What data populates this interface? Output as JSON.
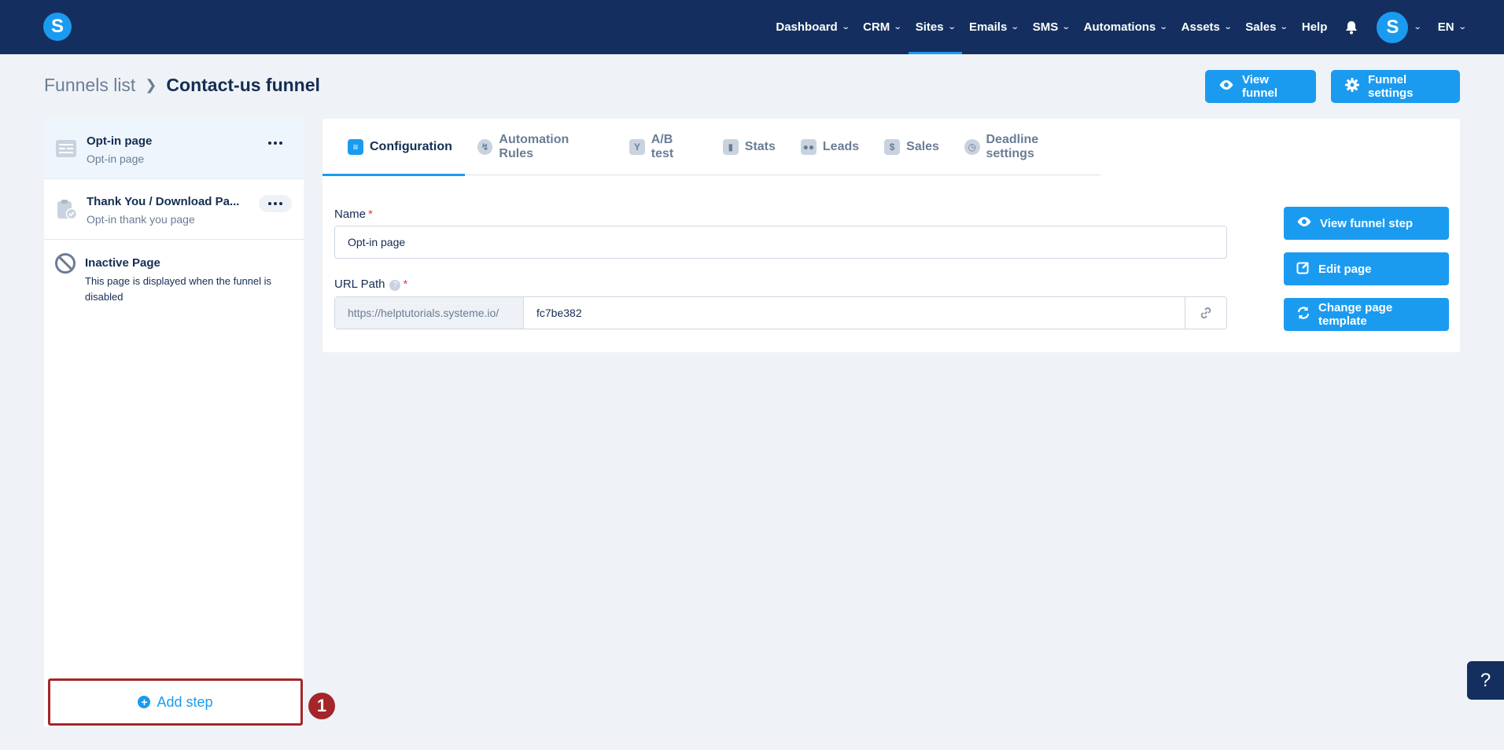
{
  "nav": {
    "logo": "S",
    "items": [
      {
        "label": "Dashboard",
        "has_dropdown": true
      },
      {
        "label": "CRM",
        "has_dropdown": true
      },
      {
        "label": "Sites",
        "has_dropdown": true,
        "active": true
      },
      {
        "label": "Emails",
        "has_dropdown": true
      },
      {
        "label": "SMS",
        "has_dropdown": true
      },
      {
        "label": "Automations",
        "has_dropdown": true
      },
      {
        "label": "Assets",
        "has_dropdown": true
      },
      {
        "label": "Sales",
        "has_dropdown": true
      },
      {
        "label": "Help",
        "has_dropdown": false
      }
    ],
    "avatar": "S",
    "language": "EN"
  },
  "breadcrumb": {
    "parent": "Funnels list",
    "current": "Contact-us funnel"
  },
  "header_buttons": {
    "view_funnel": "View funnel",
    "funnel_settings": "Funnel settings"
  },
  "steps": [
    {
      "title": "Opt-in page",
      "subtitle": "Opt-in page",
      "selected": true
    },
    {
      "title": "Thank You / Download Pa...",
      "subtitle": "Opt-in thank you page",
      "selected": false
    }
  ],
  "inactive_page": {
    "title": "Inactive Page",
    "description": "This page is displayed when the funnel is disabled"
  },
  "add_step": {
    "label": "Add step"
  },
  "marker": "1",
  "tabs": [
    {
      "label": "Configuration",
      "icon": "sliders-icon",
      "active": true
    },
    {
      "label": "Automation Rules",
      "icon": "lightning-icon"
    },
    {
      "label": "A/B test",
      "icon": "split-icon"
    },
    {
      "label": "Stats",
      "icon": "bar-chart-icon"
    },
    {
      "label": "Leads",
      "icon": "people-icon"
    },
    {
      "label": "Sales",
      "icon": "dollar-icon"
    },
    {
      "label": "Deadline settings",
      "icon": "clock-icon"
    }
  ],
  "form": {
    "name_label": "Name",
    "name_value": "Opt-in page",
    "url_label": "URL Path",
    "url_prefix": "https://helptutorials.systeme.io/",
    "url_value": "fc7be382"
  },
  "actions": {
    "view_step": "View funnel step",
    "edit_page": "Edit page",
    "change_template": "Change page template"
  },
  "help_float": "?",
  "colors": {
    "nav_bg": "#142f5f",
    "accent": "#1b9bf0",
    "page_bg": "#eff3f8",
    "highlight": "#a52628"
  }
}
